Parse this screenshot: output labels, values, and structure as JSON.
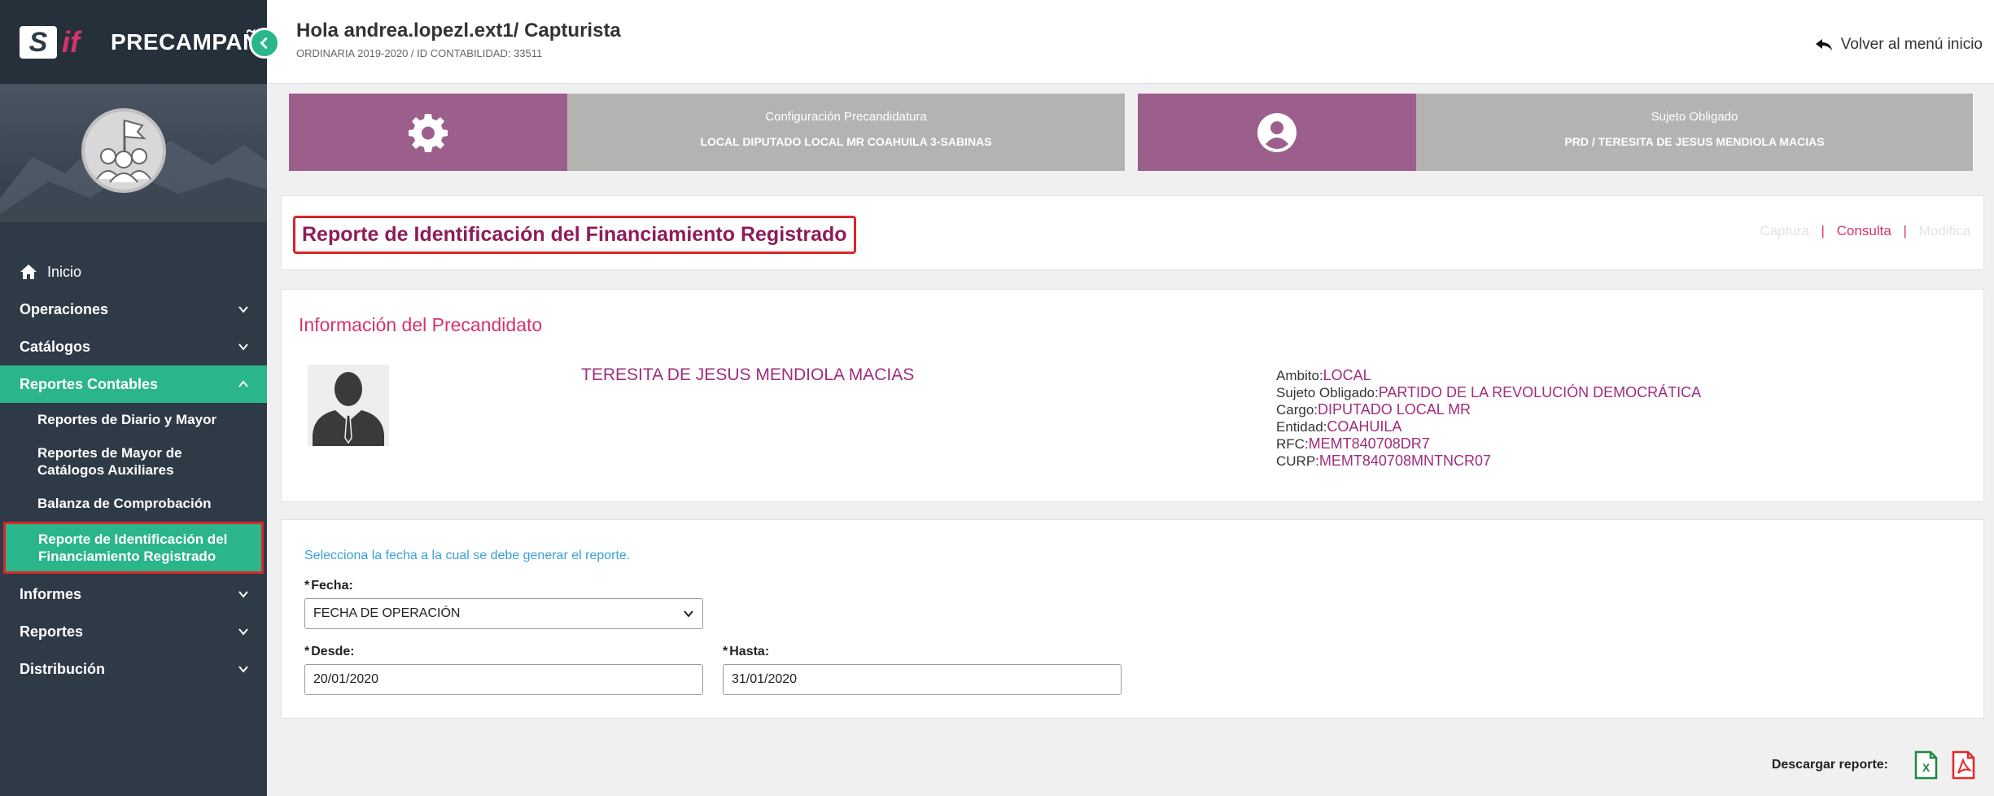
{
  "app": {
    "brand_s": "S",
    "brand_if": "if",
    "brand_title": "PRECAMPAÑA"
  },
  "header": {
    "greeting": "Hola andrea.lopezl.ext1/ Capturista",
    "subtitle": "ORDINARIA 2019-2020 / ID CONTABILIDAD: 33511",
    "back_label": "Volver al menú inicio"
  },
  "sidebar": {
    "home": "Inicio",
    "items": [
      {
        "label": "Operaciones"
      },
      {
        "label": "Catálogos"
      },
      {
        "label": "Reportes Contables"
      },
      {
        "label": "Informes"
      },
      {
        "label": "Reportes"
      },
      {
        "label": "Distribución"
      }
    ],
    "sub_items": [
      {
        "label": "Reportes de Diario y Mayor"
      },
      {
        "label": "Reportes de Mayor de Catálogos Auxiliares"
      },
      {
        "label": "Balanza de Comprobación"
      },
      {
        "label": "Reporte de Identificación del Financiamiento Registrado"
      }
    ]
  },
  "cards": {
    "config_title": "Configuración Precandidatura",
    "config_value": "LOCAL DIPUTADO LOCAL MR COAHUILA 3-SABINAS",
    "subject_title": "Sujeto Obligado",
    "subject_value": "PRD / TERESITA DE JESUS MENDIOLA MACIAS"
  },
  "report": {
    "title": "Reporte de Identificación del Financiamiento Registrado",
    "mode_capture": "Captura",
    "mode_consult": "Consulta",
    "mode_modify": "Modifica",
    "separator": "|"
  },
  "precandidate": {
    "section_title": "Información del Precandidato",
    "name": "TERESITA DE JESUS MENDIOLA MACIAS",
    "ambito_label": "Ambito:",
    "ambito_value": "LOCAL",
    "sujeto_label": "Sujeto Obligado:",
    "sujeto_value": "PARTIDO DE LA REVOLUCIÓN DEMOCRÁTICA",
    "cargo_label": "Cargo:",
    "cargo_value": "DIPUTADO LOCAL MR",
    "entidad_label": "Entidad:",
    "entidad_value": "COAHUILA",
    "rfc_label": "RFC:",
    "rfc_value": "MEMT840708DR7",
    "curp_label": "CURP:",
    "curp_value": "MEMT840708MNTNCR07"
  },
  "form": {
    "instruction": "Selecciona la fecha a la cual se debe generar el reporte.",
    "required_mark": "*",
    "fecha_label": "Fecha:",
    "fecha_value": "FECHA DE OPERACIÓN",
    "desde_label": "Desde:",
    "desde_value": "20/01/2020",
    "hasta_label": "Hasta:",
    "hasta_value": "31/01/2020"
  },
  "download": {
    "label": "Descargar reporte:"
  },
  "colors": {
    "accent_green": "#2bb58a",
    "brand_pink": "#d6336c",
    "card_purple": "#9c5f8b",
    "sidebar_bg": "#2f3a47"
  }
}
